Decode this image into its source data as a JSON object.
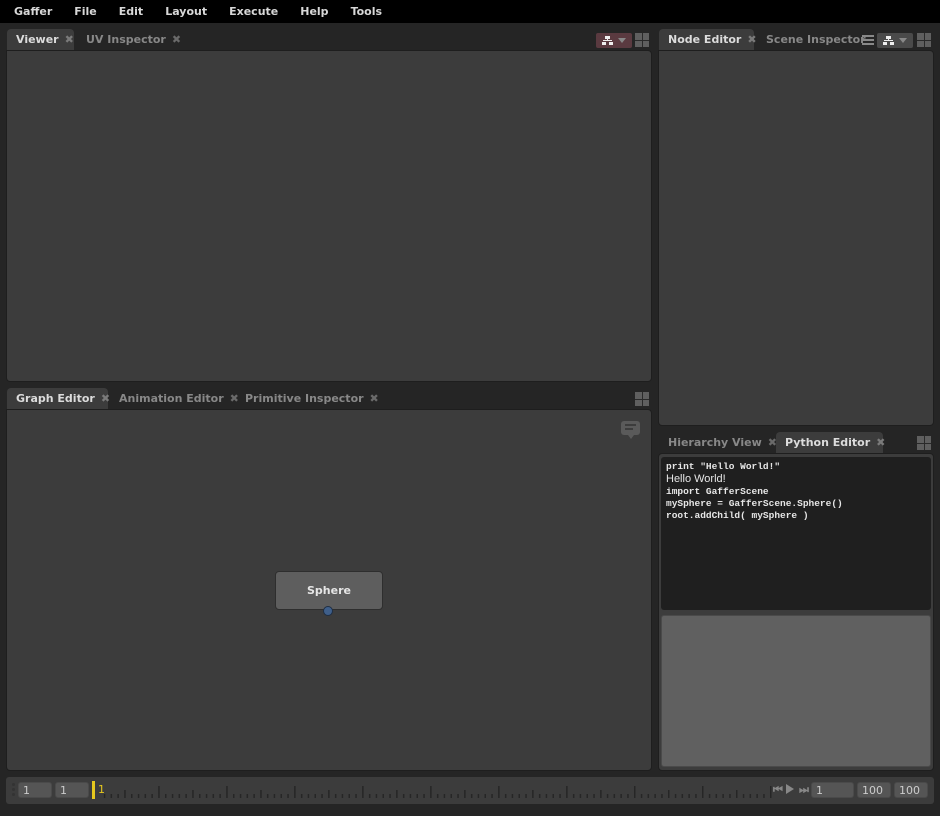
{
  "menubar": [
    "Gaffer",
    "File",
    "Edit",
    "Layout",
    "Execute",
    "Help",
    "Tools"
  ],
  "top_left": {
    "tabs": [
      {
        "label": "Viewer",
        "active": true
      },
      {
        "label": "UV Inspector",
        "active": false
      }
    ]
  },
  "top_right": {
    "tabs": [
      {
        "label": "Node Editor",
        "active": true
      },
      {
        "label": "Scene Inspector",
        "active": false
      }
    ]
  },
  "bottom_left": {
    "tabs": [
      {
        "label": "Graph Editor",
        "active": true
      },
      {
        "label": "Animation Editor",
        "active": false
      },
      {
        "label": "Primitive Inspector",
        "active": false
      }
    ],
    "node": {
      "label": "Sphere"
    }
  },
  "bottom_right": {
    "tabs": [
      {
        "label": "Hierarchy View",
        "active": false
      },
      {
        "label": "Python Editor",
        "active": true
      }
    ],
    "output": [
      {
        "type": "code",
        "text": "print \"Hello World!\""
      },
      {
        "type": "out",
        "text": "Hello World!"
      },
      {
        "type": "code",
        "text": "import GafferScene"
      },
      {
        "type": "code",
        "text": "mySphere = GafferScene.Sphere()"
      },
      {
        "type": "code",
        "text": "root.addChild( mySphere )"
      }
    ]
  },
  "timeline": {
    "range_start": "1",
    "play_start": "1",
    "current_frame": "1",
    "frame_field": "1",
    "play_end": "100",
    "range_end": "100",
    "frame_min": 1,
    "frame_max": 100
  },
  "colors": {
    "current_frame": "#e6c81e",
    "plug": "#3f5f8a",
    "pinned_context": "#5a3a40"
  }
}
